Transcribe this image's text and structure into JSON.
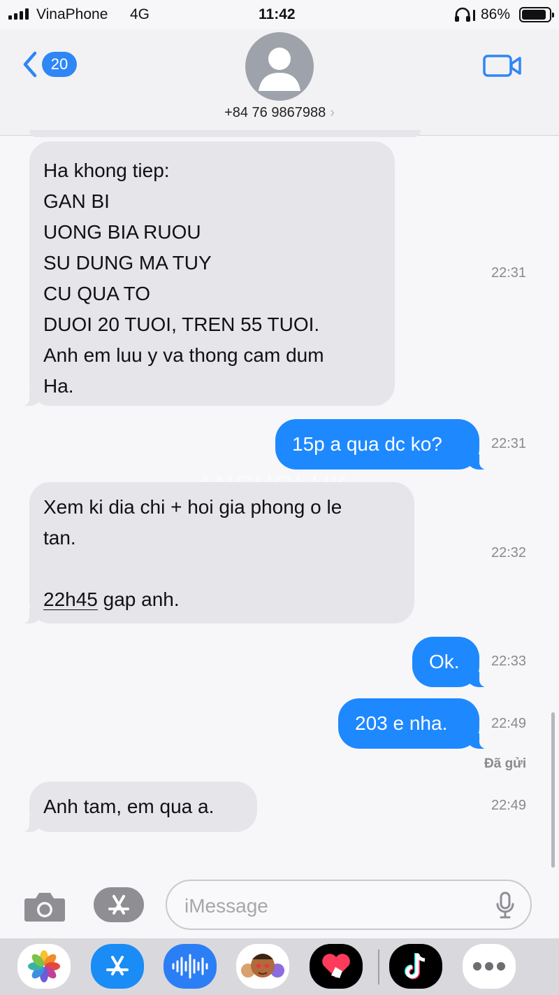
{
  "status_bar": {
    "carrier": "VinaPhone",
    "network": "4G",
    "time": "11:42",
    "battery": "86%"
  },
  "header": {
    "back_count": "20",
    "contact_number": "+84 76 9867988",
    "chevron": "›"
  },
  "messages": [
    {
      "direction": "incoming",
      "lines": [
        "Ha khong tiep:",
        "GAN BI",
        "UONG BIA RUOU",
        "SU DUNG MA TUY",
        "CU QUA TO",
        "DUOI 20 TUOI, TREN 55 TUOI.",
        "Anh em luu y va thong cam dum",
        "Ha."
      ],
      "time": "22:31"
    },
    {
      "direction": "outgoing",
      "lines": [
        "15p a qua dc ko?"
      ],
      "time": "22:31"
    },
    {
      "direction": "incoming",
      "lines": [
        "Xem ki dia chi + hoi gia phong o le",
        "tan.",
        "",
        "gap anh."
      ],
      "link": "22h45",
      "time": "22:32"
    },
    {
      "direction": "outgoing",
      "lines": [
        "Ok."
      ],
      "time": "22:33"
    },
    {
      "direction": "outgoing",
      "lines": [
        "203 e nha."
      ],
      "time": "22:49"
    },
    {
      "direction": "incoming",
      "lines": [
        "Anh tam, em qua a."
      ],
      "time": "22:49"
    }
  ],
  "delivery_status": "Đã gửi",
  "watermark": "ANCHOI.UK",
  "input": {
    "placeholder": "iMessage"
  },
  "icons": {
    "status": [
      "signal-icon",
      "headphones-icon",
      "battery-icon"
    ],
    "header": [
      "back-chevron-icon",
      "contact-avatar-icon",
      "video-camera-icon"
    ],
    "input_bar": [
      "camera-icon",
      "app-store-icon",
      "microphone-icon"
    ],
    "app_drawer": [
      "photos-app-icon",
      "app-store-app-icon",
      "audio-message-app-icon",
      "memoji-app-icon",
      "digital-touch-app-icon",
      "tiktok-app-icon",
      "more-apps-icon"
    ]
  },
  "colors": {
    "outgoing_bubble": "#1e88ff",
    "incoming_bubble": "#e5e5ea",
    "accent": "#2f86f5",
    "background": "#f7f7f9"
  }
}
